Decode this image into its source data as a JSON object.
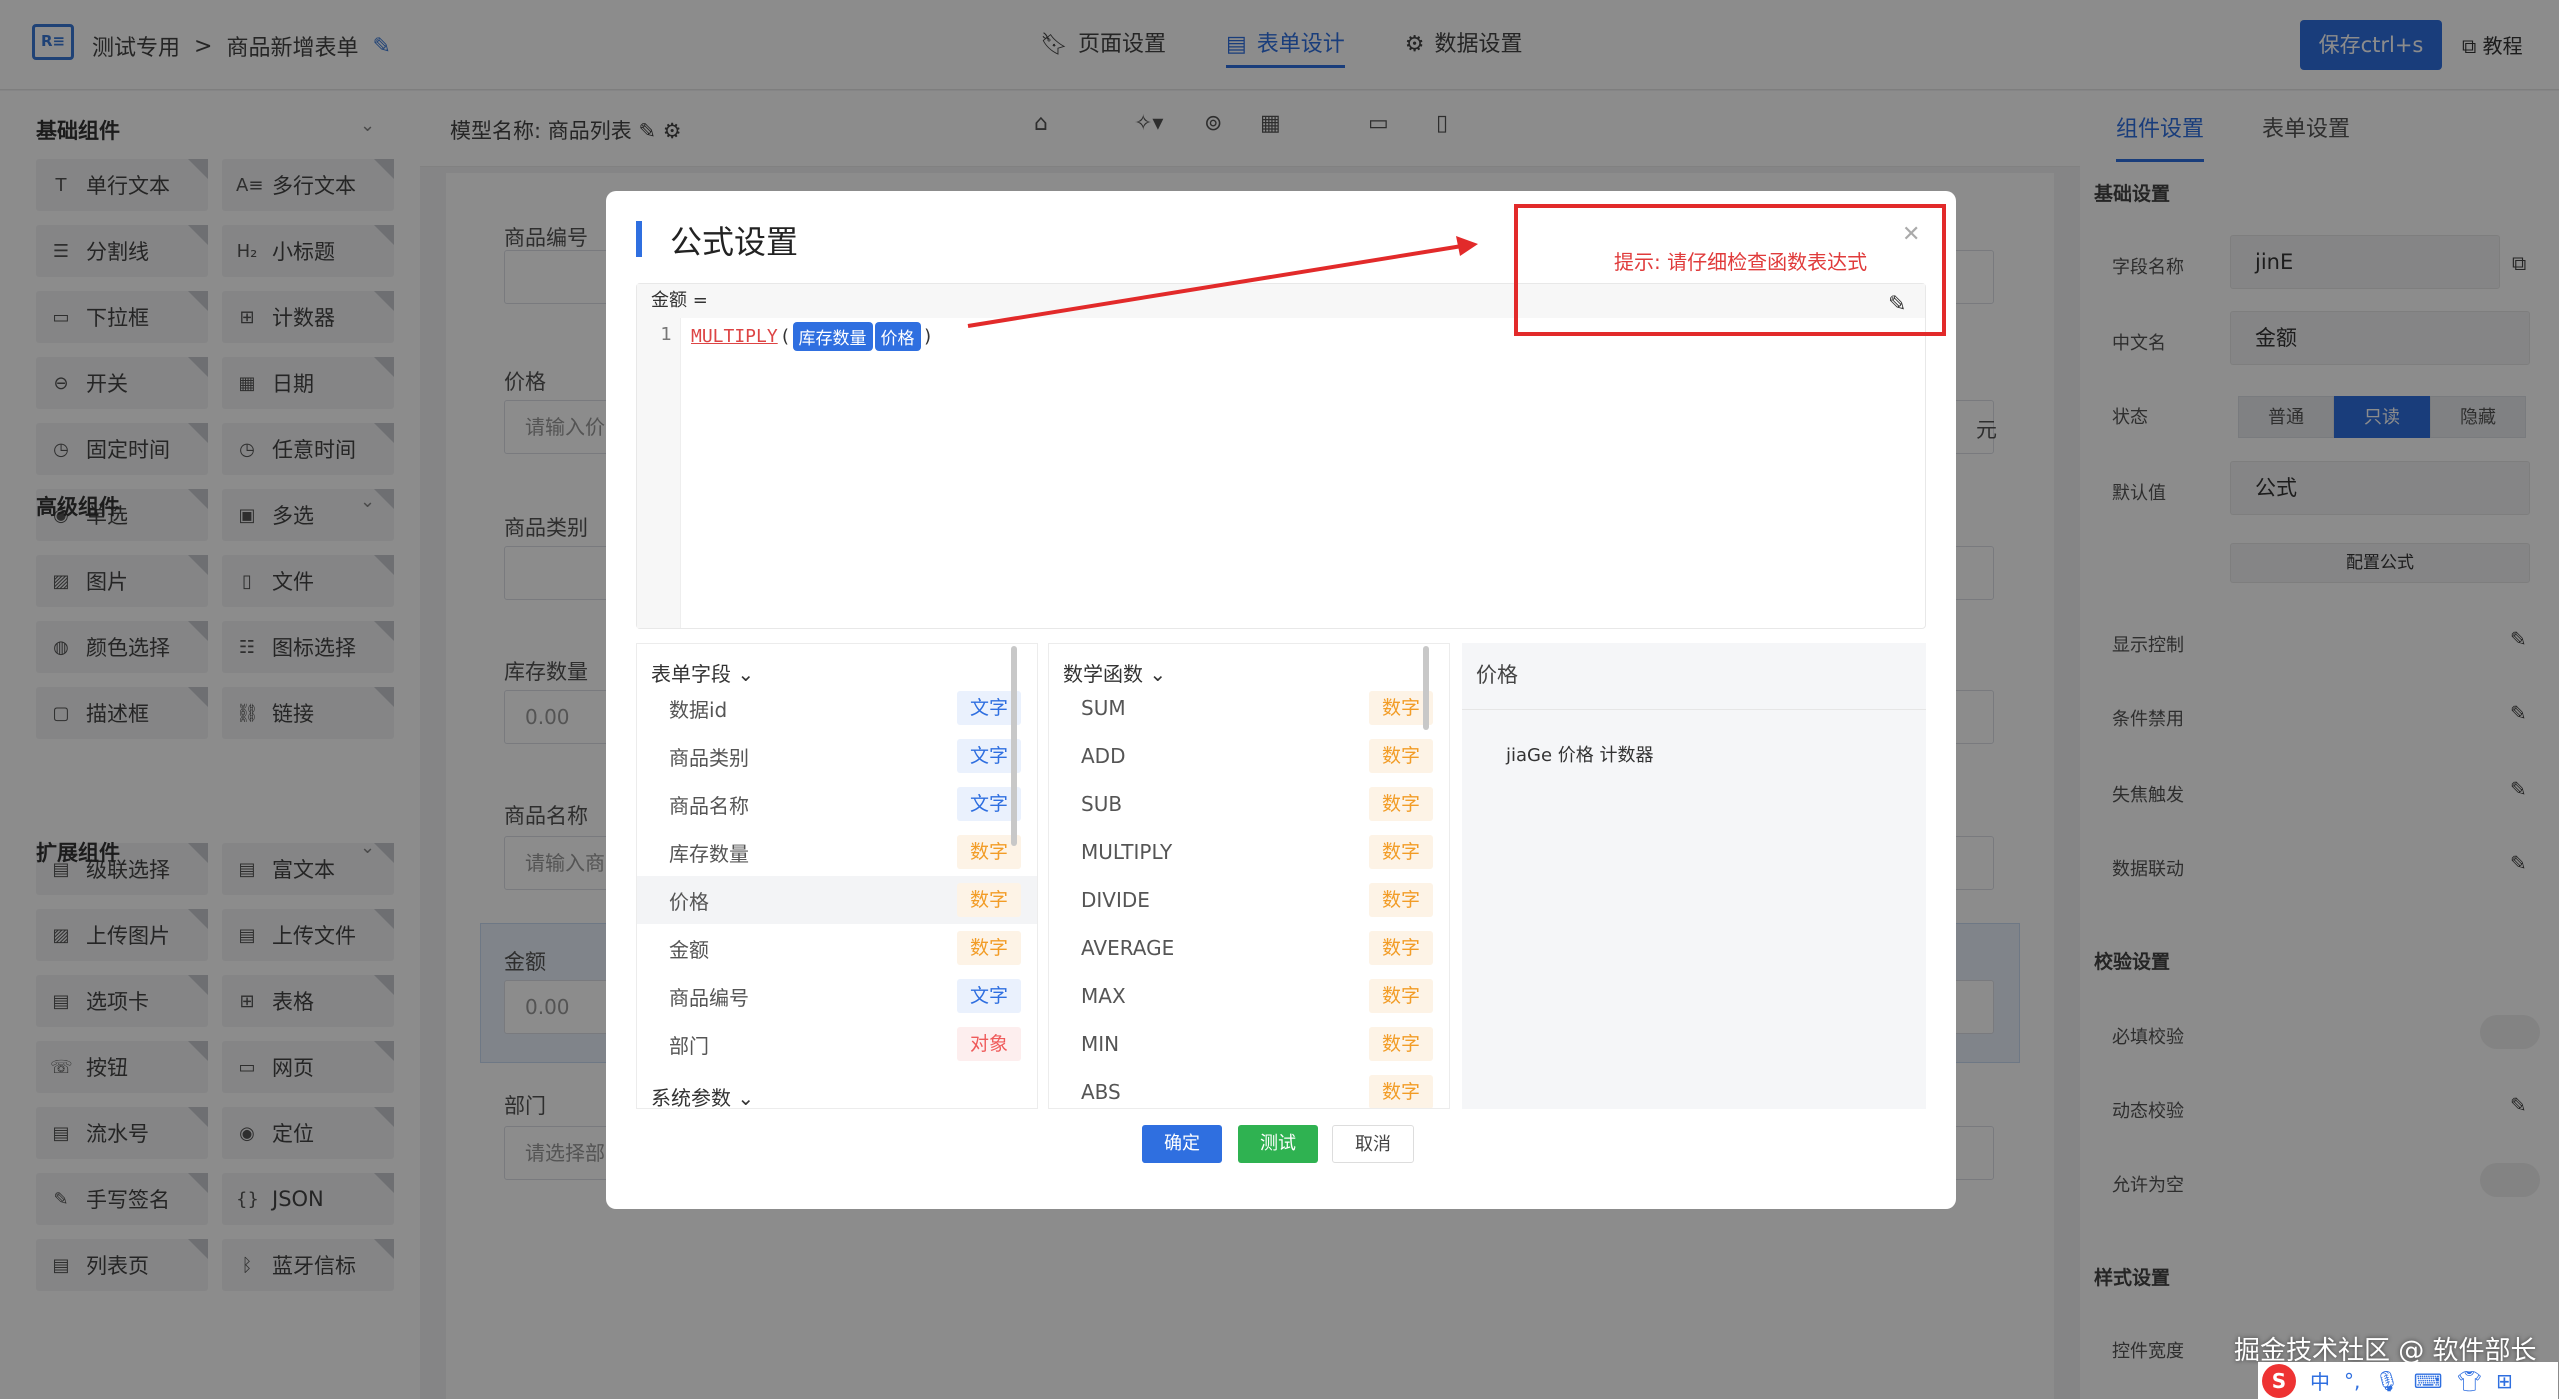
{
  "header": {
    "breadcrumb_root": "测试专用",
    "breadcrumb_sep": ">",
    "breadcrumb_current": "商品新增表单",
    "tabs": [
      {
        "label": "页面设置",
        "icon": "bookmark-icon"
      },
      {
        "label": "表单设计",
        "icon": "document-icon"
      },
      {
        "label": "数据设置",
        "icon": "gear-icon"
      }
    ],
    "active_tab": "表单设计",
    "save_label": "保存ctrl+s",
    "help_label": "教程"
  },
  "left_panel": {
    "groups": [
      {
        "title": "基础组件",
        "items": [
          {
            "label": "单行文本",
            "icon": "T"
          },
          {
            "label": "多行文本",
            "icon": "A≡"
          },
          {
            "label": "分割线",
            "icon": "☰"
          },
          {
            "label": "小标题",
            "icon": "H₂"
          },
          {
            "label": "下拉框",
            "icon": "▭"
          },
          {
            "label": "计数器",
            "icon": "⊞"
          },
          {
            "label": "开关",
            "icon": "⊖"
          },
          {
            "label": "日期",
            "icon": "▦"
          },
          {
            "label": "固定时间",
            "icon": "◷"
          },
          {
            "label": "任意时间",
            "icon": "◷"
          },
          {
            "label": "单选",
            "icon": "◉"
          },
          {
            "label": "多选",
            "icon": "▣"
          },
          {
            "label": "图片",
            "icon": "▨"
          },
          {
            "label": "文件",
            "icon": "▯"
          },
          {
            "label": "颜色选择",
            "icon": "◍"
          },
          {
            "label": "图标选择",
            "icon": "☷"
          },
          {
            "label": "描述框",
            "icon": "▢"
          },
          {
            "label": "链接",
            "icon": "⛓"
          }
        ]
      },
      {
        "title": "高级组件",
        "items": [
          {
            "label": "级联选择",
            "icon": "▤"
          },
          {
            "label": "富文本",
            "icon": "▤"
          },
          {
            "label": "上传图片",
            "icon": "▨"
          },
          {
            "label": "上传文件",
            "icon": "▤"
          },
          {
            "label": "选项卡",
            "icon": "▤"
          },
          {
            "label": "表格",
            "icon": "⊞"
          },
          {
            "label": "按钮",
            "icon": "☏"
          },
          {
            "label": "网页",
            "icon": "▭"
          },
          {
            "label": "流水号",
            "icon": "▤"
          },
          {
            "label": "定位",
            "icon": "◉"
          },
          {
            "label": "手写签名",
            "icon": "✎"
          },
          {
            "label": "JSON",
            "icon": "{}"
          },
          {
            "label": "列表页",
            "icon": "▤"
          },
          {
            "label": "蓝牙信标",
            "icon": "ᛒ"
          }
        ]
      },
      {
        "title": "扩展组件",
        "items": []
      }
    ]
  },
  "canvas": {
    "model_label": "模型名称: 商品列表",
    "fields": [
      {
        "label": "商品编号",
        "placeholder": ""
      },
      {
        "label": "价格",
        "placeholder": "请输入价",
        "suffix": "元"
      },
      {
        "label": "商品类别",
        "placeholder": ""
      },
      {
        "label": "库存数量",
        "placeholder": "0.00"
      },
      {
        "label": "商品名称",
        "placeholder": "请输入商"
      },
      {
        "label": "金额",
        "placeholder": "0.00"
      },
      {
        "label": "部门",
        "placeholder": "请选择部"
      }
    ]
  },
  "right_panel": {
    "tabs": [
      "组件设置",
      "表单设置"
    ],
    "active_tab": "组件设置",
    "sections": {
      "basic": "基础设置",
      "validate": "校验设置",
      "style": "样式设置"
    },
    "field_name_label": "字段名称",
    "field_name_value": "jinE",
    "cn_name_label": "中文名",
    "cn_name_value": "金额",
    "state_label": "状态",
    "state_options": [
      "普通",
      "只读",
      "隐藏"
    ],
    "state_selected": "只读",
    "default_label": "默认值",
    "default_value": "公式",
    "config_formula": "配置公式",
    "display_control": "显示控制",
    "cond_disable": "条件禁用",
    "blur_trigger": "失焦触发",
    "data_link": "数据联动",
    "required_check": "必填校验",
    "dynamic_check": "动态校验",
    "allow_empty": "允许为空",
    "control_width": "控件宽度"
  },
  "dialog": {
    "title": "公式设置",
    "editor_header": "金额 =",
    "line_number": "1",
    "formula_fn": "MULTIPLY",
    "formula_args": [
      "库存数量",
      "价格"
    ],
    "hint": "提示: 请仔细检查函数表达式",
    "field_list_title": "表单字段",
    "fields": [
      {
        "name": "数据id",
        "type": "文字",
        "kind": "txt"
      },
      {
        "name": "商品类别",
        "type": "文字",
        "kind": "txt"
      },
      {
        "name": "商品名称",
        "type": "文字",
        "kind": "txt"
      },
      {
        "name": "库存数量",
        "type": "数字",
        "kind": "num"
      },
      {
        "name": "价格",
        "type": "数字",
        "kind": "num"
      },
      {
        "name": "金额",
        "type": "数字",
        "kind": "num"
      },
      {
        "name": "商品编号",
        "type": "文字",
        "kind": "txt"
      },
      {
        "name": "部门",
        "type": "对象",
        "kind": "obj"
      }
    ],
    "sys_params": "系统参数",
    "func_list_title": "数学函数",
    "functions": [
      {
        "name": "SUM",
        "type": "数字"
      },
      {
        "name": "ADD",
        "type": "数字"
      },
      {
        "name": "SUB",
        "type": "数字"
      },
      {
        "name": "MULTIPLY",
        "type": "数字"
      },
      {
        "name": "DIVIDE",
        "type": "数字"
      },
      {
        "name": "AVERAGE",
        "type": "数字"
      },
      {
        "name": "MAX",
        "type": "数字"
      },
      {
        "name": "MIN",
        "type": "数字"
      },
      {
        "name": "ABS",
        "type": "数字"
      }
    ],
    "desc_title": "价格",
    "desc_text": "jiaGe 价格 计数器",
    "confirm": "确定",
    "test": "测试",
    "cancel": "取消"
  },
  "watermark": "掘金技术社区 @ 软件部长",
  "ime_label": "中"
}
